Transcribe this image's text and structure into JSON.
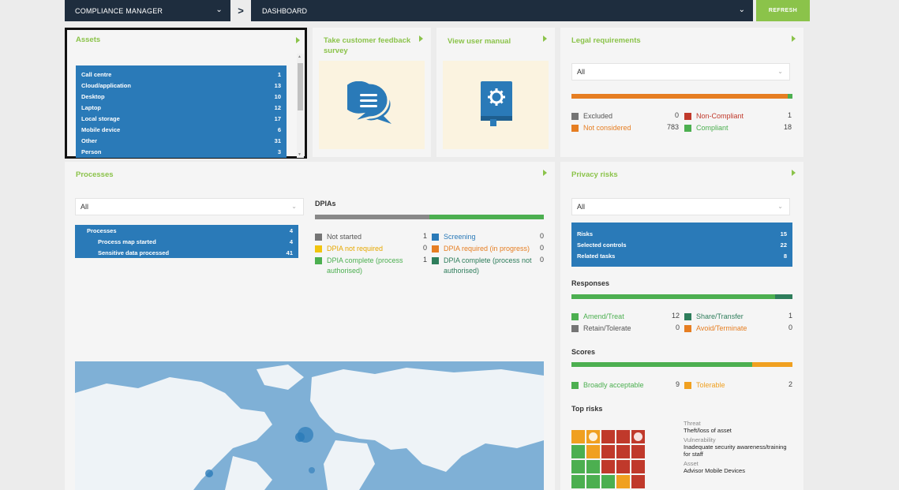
{
  "topbar": {
    "module": "COMPLIANCE MANAGER",
    "separator": ">",
    "page": "DASHBOARD",
    "refresh": "REFRESH"
  },
  "assets": {
    "title": "Assets",
    "items": [
      {
        "label": "Call centre",
        "count": "1"
      },
      {
        "label": "Cloud/application",
        "count": "13"
      },
      {
        "label": "Desktop",
        "count": "10"
      },
      {
        "label": "Laptop",
        "count": "12"
      },
      {
        "label": "Local storage",
        "count": "17"
      },
      {
        "label": "Mobile device",
        "count": "6"
      },
      {
        "label": "Other",
        "count": "31"
      },
      {
        "label": "Person",
        "count": "3"
      }
    ]
  },
  "survey": {
    "title": "Take customer feedback survey"
  },
  "manual": {
    "title": "View user manual"
  },
  "legal": {
    "title": "Legal requirements",
    "filter": "All",
    "bar": [
      {
        "color": "#e67e22",
        "value": 783
      },
      {
        "color": "#4caf50",
        "value": 18
      }
    ],
    "legend": [
      {
        "label": "Excluded",
        "value": "0",
        "color": "#757575",
        "text_color": "#555555"
      },
      {
        "label": "Non-Compliant",
        "value": "1",
        "color": "#c0392b",
        "text_color": "#c0392b"
      },
      {
        "label": "Not considered",
        "value": "783",
        "color": "#e67e22",
        "text_color": "#e67e22"
      },
      {
        "label": "Compliant",
        "value": "18",
        "color": "#4caf50",
        "text_color": "#4caf50"
      }
    ]
  },
  "processes": {
    "title": "Processes",
    "filter": "All",
    "list": [
      {
        "label": "Processes",
        "count": "4"
      },
      {
        "label": "Process map started",
        "count": "4"
      },
      {
        "label": "Sensitive data processed",
        "count": "41"
      }
    ]
  },
  "dpias": {
    "title": "DPIAs",
    "bar": [
      {
        "color": "#888888",
        "value": 1
      },
      {
        "color": "#4caf50",
        "value": 1
      }
    ],
    "legend_left": [
      {
        "label": "Not started",
        "value": "1",
        "color": "#757575",
        "text_color": "#555555"
      },
      {
        "label": "DPIA not required",
        "value": "0",
        "color": "#f1c40f",
        "text_color": "#e6a800"
      },
      {
        "label": "DPIA complete (process authorised)",
        "value": "1",
        "color": "#4caf50",
        "text_color": "#4caf50"
      }
    ],
    "legend_right": [
      {
        "label": "Screening",
        "value": "0",
        "color": "#2a7ab8",
        "text_color": "#2a7ab8"
      },
      {
        "label": "DPIA required (in progress)",
        "value": "0",
        "color": "#e67e22",
        "text_color": "#e67e22"
      },
      {
        "label": "DPIA complete (process not authorised)",
        "value": "0",
        "color": "#2e7d5b",
        "text_color": "#2e7d5b"
      }
    ]
  },
  "privacy": {
    "title": "Privacy risks",
    "filter": "All",
    "list": [
      {
        "label": "Risks",
        "count": "15"
      },
      {
        "label": "Selected controls",
        "count": "22"
      },
      {
        "label": "Related tasks",
        "count": "8"
      }
    ],
    "responses": {
      "title": "Responses",
      "bar": [
        {
          "color": "#4caf50",
          "value": 12
        },
        {
          "color": "#2e7d5b",
          "value": 1
        }
      ],
      "legend": [
        {
          "label": "Amend/Treat",
          "value": "12",
          "color": "#4caf50",
          "text_color": "#4caf50"
        },
        {
          "label": "Share/Transfer",
          "value": "1",
          "color": "#2e7d5b",
          "text_color": "#2e7d5b"
        },
        {
          "label": "Retain/Tolerate",
          "value": "0",
          "color": "#757575",
          "text_color": "#555555"
        },
        {
          "label": "Avoid/Terminate",
          "value": "0",
          "color": "#e67e22",
          "text_color": "#e67e22"
        }
      ]
    },
    "scores": {
      "title": "Scores",
      "bar": [
        {
          "color": "#4caf50",
          "value": 9
        },
        {
          "color": "#f0a020",
          "value": 2
        }
      ],
      "legend": [
        {
          "label": "Broadly acceptable",
          "value": "9",
          "color": "#4caf50",
          "text_color": "#4caf50"
        },
        {
          "label": "Tolerable",
          "value": "2",
          "color": "#f0a020",
          "text_color": "#f0a020"
        }
      ]
    },
    "top_risks": {
      "title": "Top risks",
      "threat_label": "Threat",
      "threat": "Theft/loss of asset",
      "vulnerability_label": "Vulnerability",
      "vulnerability": "Inadequate security awareness/training for staff",
      "asset_label": "Asset",
      "asset": "Advisor Mobile Devices",
      "grid": [
        [
          "#f0a020",
          "#f0a020",
          "#c0392b",
          "#c0392b",
          "#c0392b"
        ],
        [
          "#4caf50",
          "#f0a020",
          "#c0392b",
          "#c0392b",
          "#c0392b"
        ],
        [
          "#4caf50",
          "#4caf50",
          "#c0392b",
          "#c0392b",
          "#c0392b"
        ],
        [
          "#4caf50",
          "#4caf50",
          "#4caf50",
          "#f0a020",
          "#c0392b"
        ],
        [
          "#4caf50",
          "#4caf50",
          "#4caf50",
          "#f0a020",
          "#f0a020"
        ]
      ],
      "markers": [
        [
          0,
          1
        ],
        [
          0,
          4
        ]
      ]
    }
  }
}
